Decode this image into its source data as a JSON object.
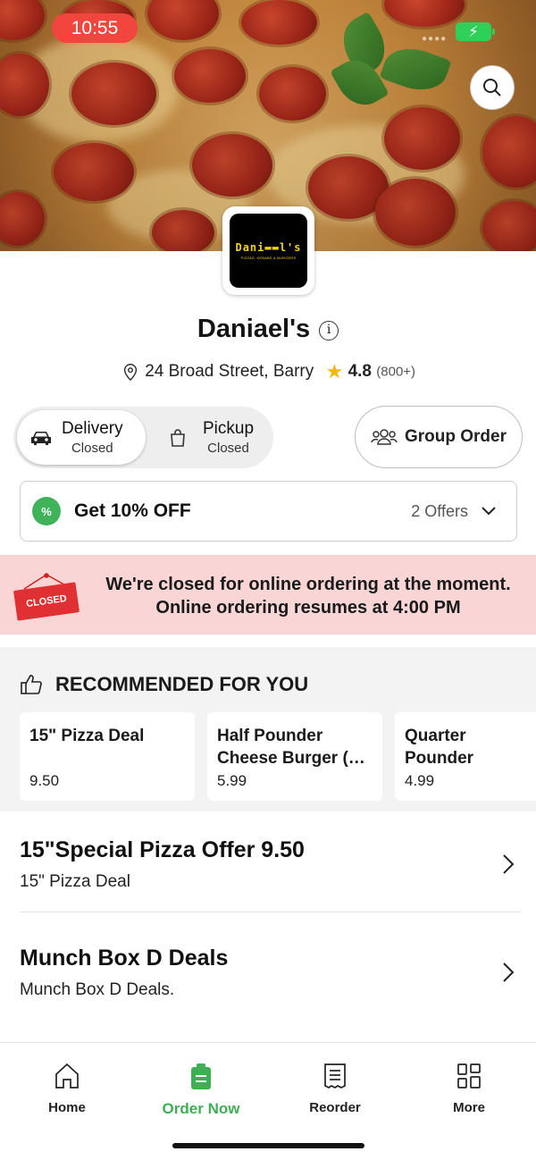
{
  "status_bar": {
    "time": "10:55"
  },
  "restaurant": {
    "logo_text": "Dani▬▬l's",
    "logo_tagline": "PIZZAS, KEBABS & BURGERS",
    "name": "Daniael's",
    "address": "24 Broad Street, Barry",
    "rating": "4.8",
    "rating_count": "(800+)"
  },
  "order_mode": {
    "delivery": {
      "label": "Delivery",
      "status": "Closed",
      "selected": true
    },
    "pickup": {
      "label": "Pickup",
      "status": "Closed",
      "selected": false
    },
    "group_order_label": "Group Order"
  },
  "offers": {
    "title": "Get 10% OFF",
    "count_label": "2 Offers",
    "badge": "%"
  },
  "closed_notice": {
    "sign_text": "CLOSED",
    "line1": "We're closed for online ordering at the moment.",
    "line2": "Online ordering resumes at 4:00 PM"
  },
  "recommended": {
    "heading": "RECOMMENDED FOR YOU",
    "items": [
      {
        "name": "15\" Pizza Deal",
        "price": "9.50"
      },
      {
        "name": "Half Pounder Cheese Burger (…",
        "price": "5.99"
      },
      {
        "name": "Quarter Pounder Cheese Burger (",
        "price": "4.99"
      }
    ]
  },
  "categories": [
    {
      "title": "15\"Special Pizza Offer 9.50",
      "subtitle": "15\" Pizza Deal"
    },
    {
      "title": "Munch Box D Deals",
      "subtitle": "Munch Box D Deals."
    }
  ],
  "bottom_nav": {
    "items": [
      {
        "label": "Home",
        "icon": "home-icon"
      },
      {
        "label": "Order Now",
        "icon": "order-icon",
        "active": true
      },
      {
        "label": "Reorder",
        "icon": "receipt-icon"
      },
      {
        "label": "More",
        "icon": "grid-icon"
      }
    ]
  },
  "colors": {
    "accent_green": "#3fae55",
    "closed_banner_bg": "#f9d5d6",
    "closed_sign_red": "#e03034",
    "time_pill_red": "#f2453d",
    "star_yellow": "#f6b800"
  }
}
